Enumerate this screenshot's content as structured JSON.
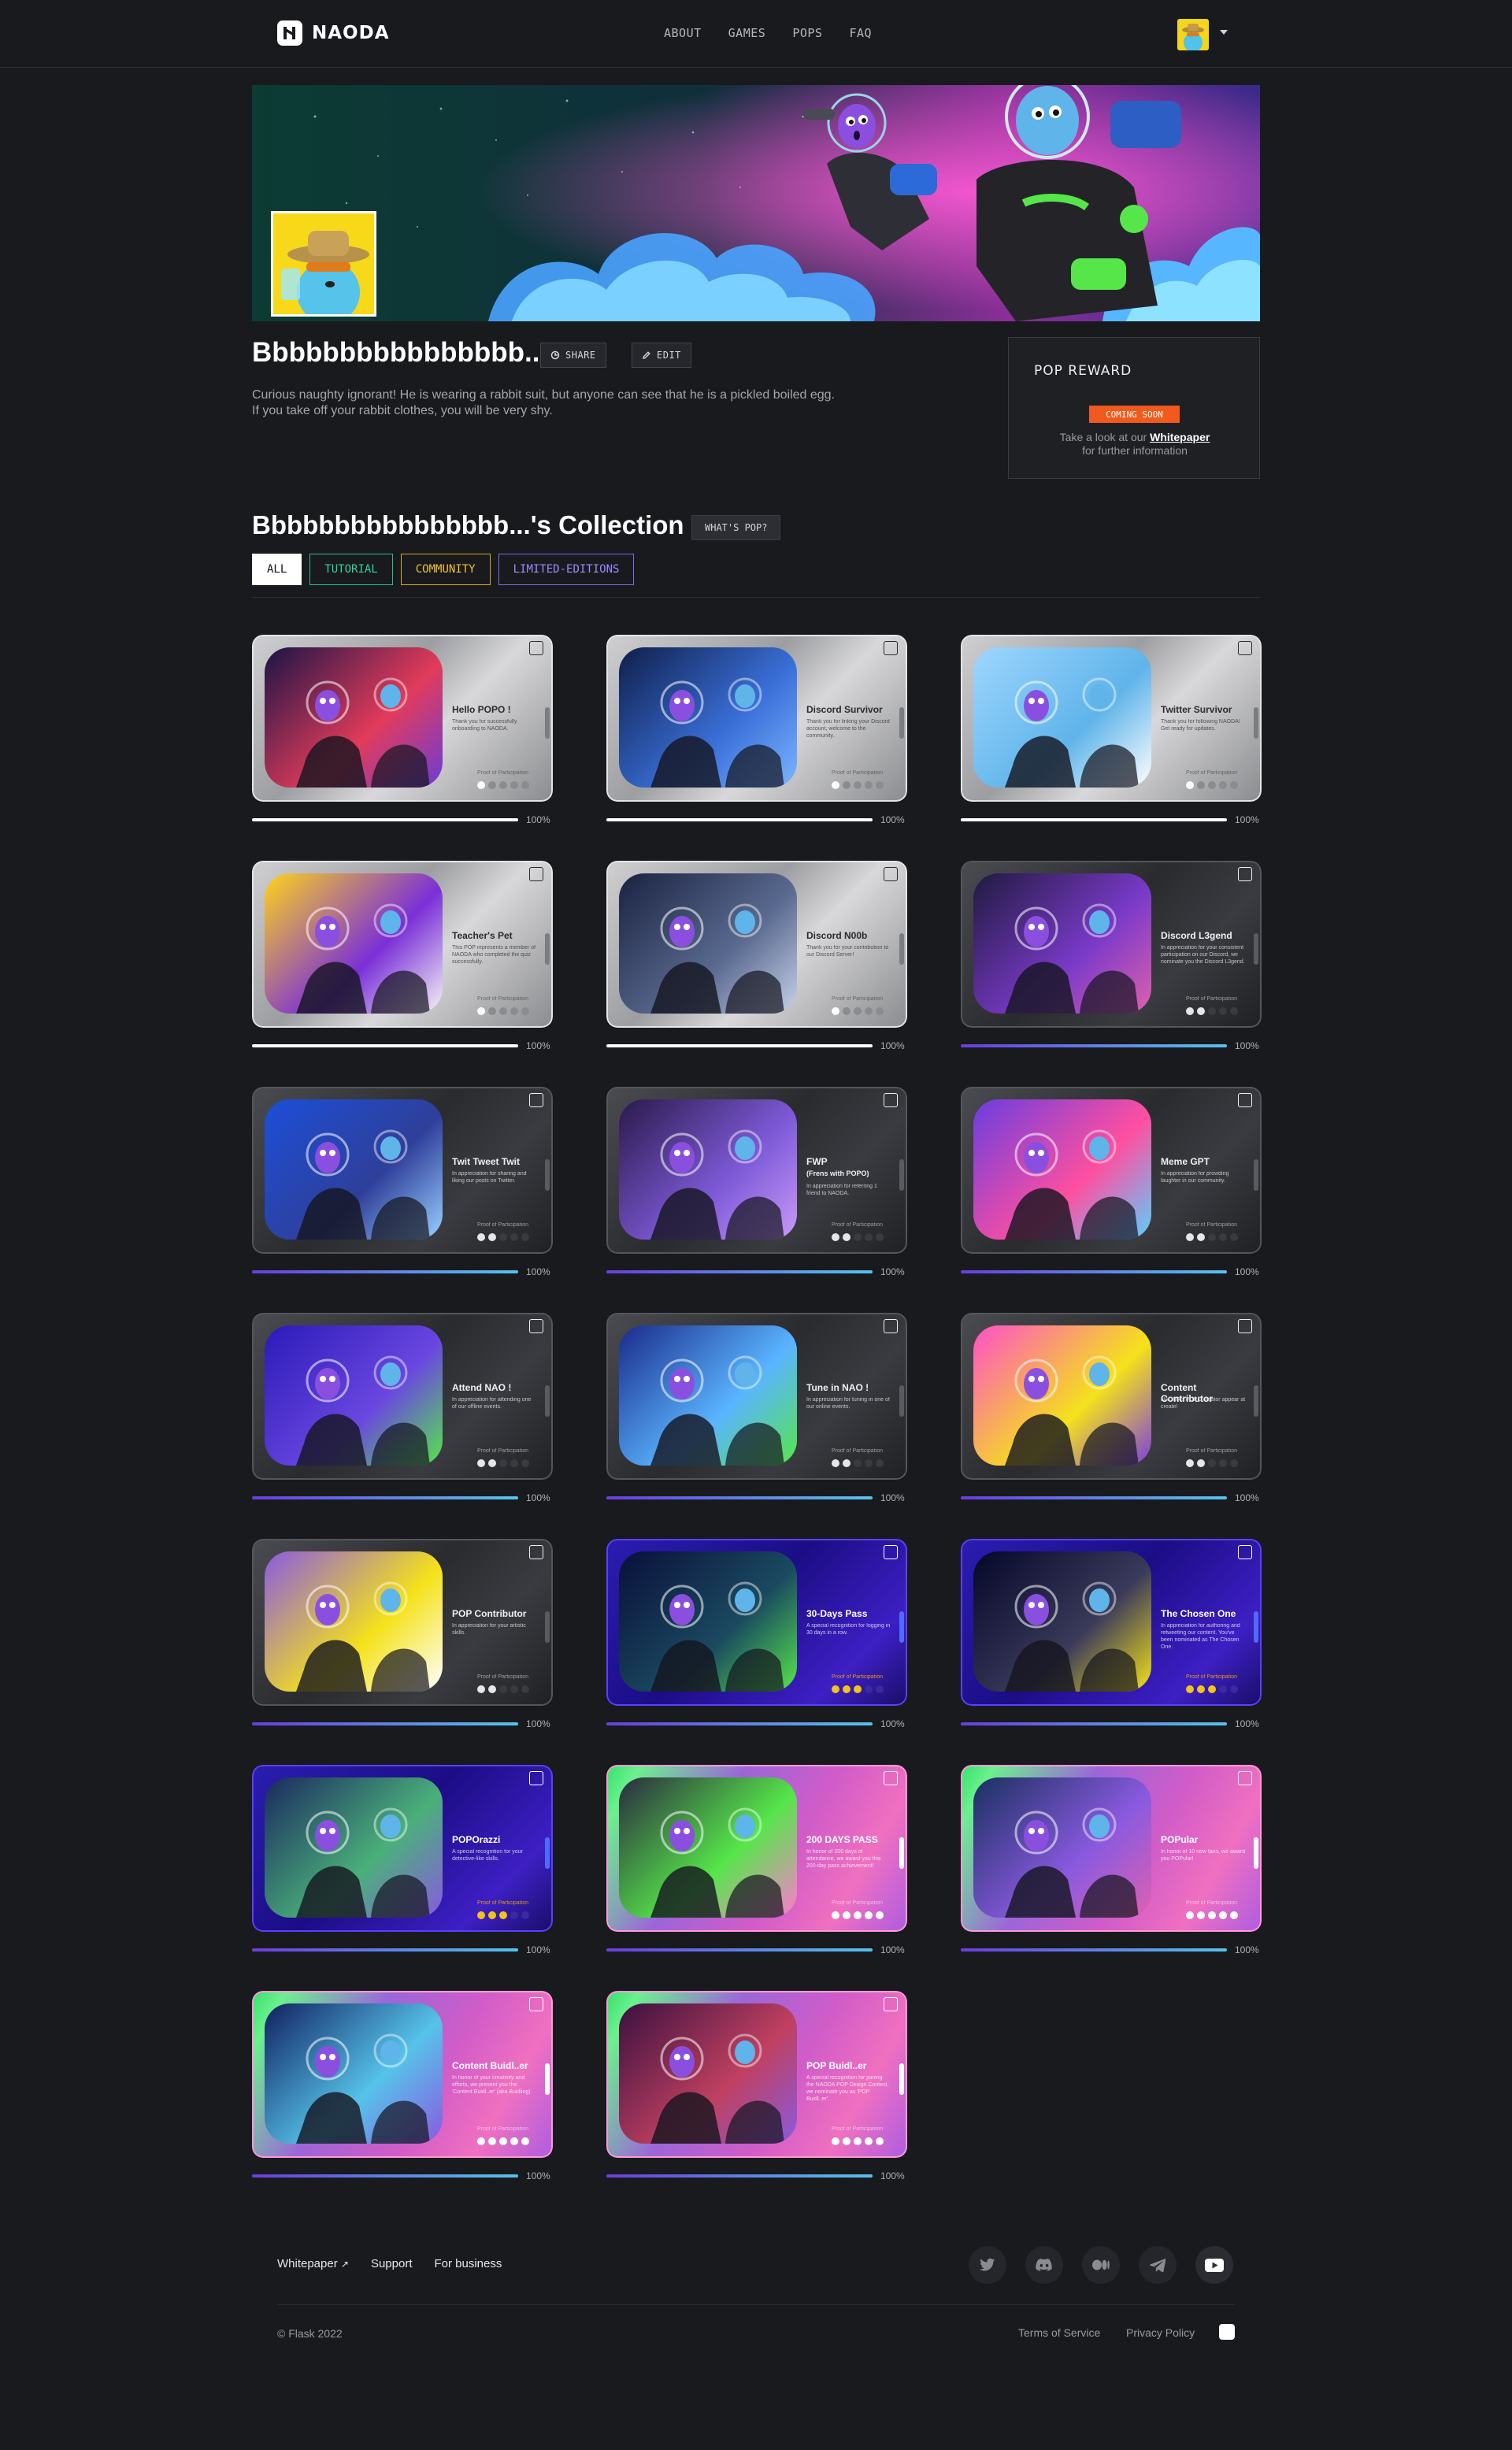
{
  "nav": {
    "brand": "NAODA",
    "items": [
      "ABOUT",
      "GAMES",
      "POPS",
      "FAQ"
    ]
  },
  "profile": {
    "name": "Bbbbbbbbbbbbbbbb...",
    "share_label": "SHARE",
    "edit_label": "EDIT",
    "bio_line1": "Curious naughty ignorant! He is wearing a rabbit suit, but anyone can see that he is a pickled boiled egg.",
    "bio_line2": "If you take off your rabbit clothes, you will be very shy."
  },
  "reward": {
    "title": "POP REWARD",
    "badge": "COMING SOON",
    "note_prefix": "Take a look at our ",
    "note_link": "Whitepaper",
    "note_suffix": "for further information"
  },
  "collection": {
    "title": "Bbbbbbbbbbbbbbbb...'s Collection",
    "whats_pop": "WHAT'S POP?",
    "filters": [
      "ALL",
      "TUTORIAL",
      "COMMUNITY",
      "LIMITED-EDITIONS"
    ],
    "pop_label": "Proof of Participation",
    "cards": [
      {
        "title": "Hello POPO !",
        "desc": "Thank you for successfully onboarding to NAODA.",
        "progress": "100%",
        "stars_on": 1,
        "stars_total": 5
      },
      {
        "title": "Discord Survivor",
        "desc": "Thank you for linking your Discord account, welcome to the community.",
        "progress": "100%",
        "stars_on": 1,
        "stars_total": 5
      },
      {
        "title": "Twitter Survivor",
        "desc": "Thank you for following NAODA! Get ready for updates.",
        "progress": "100%",
        "stars_on": 1,
        "stars_total": 5
      },
      {
        "title": "Teacher's Pet",
        "desc": "This POP represents a member of NAODA who completed the quiz successfully.",
        "progress": "100%",
        "stars_on": 1,
        "stars_total": 5
      },
      {
        "title": "Discord N00b",
        "desc": "Thank you for your contribution to our Discord Server!",
        "progress": "100%",
        "stars_on": 1,
        "stars_total": 5
      },
      {
        "title": "Discord L3gend",
        "desc": "In appreciation for your consistent participation on our Discord, we nominate you the Discord L3gend.",
        "progress": "100%",
        "stars_on": 2,
        "stars_total": 5
      },
      {
        "title": "Twit Tweet Twit",
        "desc": "In appreciation for sharing and liking our posts on Twitter.",
        "progress": "100%",
        "stars_on": 2,
        "stars_total": 5
      },
      {
        "title": "FWP",
        "subtitle": "(Frens with POPO)",
        "desc": "In appreciation for referring 1 friend to NAODA.",
        "progress": "100%",
        "stars_on": 2,
        "stars_total": 5
      },
      {
        "title": "Meme GPT",
        "desc": "In appreciation for providing laughter in our community.",
        "progress": "100%",
        "stars_on": 2,
        "stars_total": 5
      },
      {
        "title": "Attend NAO !",
        "desc": "In appreciation for attending one of our offline events.",
        "progress": "100%",
        "stars_on": 2,
        "stars_total": 5
      },
      {
        "title": "Tune in NAO !",
        "desc": "In appreciation for tuning in one of our online events.",
        "progress": "100%",
        "stars_on": 2,
        "stars_total": 5
      },
      {
        "title": "Content Contributor",
        "desc": "NAODA's POPO creator appear at create!",
        "progress": "100%",
        "stars_on": 2,
        "stars_total": 5
      },
      {
        "title": "POP Contributor",
        "desc": "In appreciation for your artistic skills.",
        "progress": "100%",
        "stars_on": 2,
        "stars_total": 5
      },
      {
        "title": "30-Days Pass",
        "desc": "A special recognition for logging in 30 days in a row.",
        "progress": "100%",
        "stars_on": 3,
        "stars_total": 5
      },
      {
        "title": "The Chosen One",
        "desc": "In appreciation for authoring and retweeting our content. You've been nominated as The Chosen One.",
        "progress": "100%",
        "stars_on": 3,
        "stars_total": 5
      },
      {
        "title": "POPOrazzi",
        "desc": "A special recognition for your detective-like skills.",
        "progress": "100%",
        "stars_on": 3,
        "stars_total": 5
      },
      {
        "title": "200 DAYS PASS",
        "desc": "In honor of 200 days of attendance, we award you this 200-day pass achievement!",
        "progress": "100%",
        "stars_on": 5,
        "stars_total": 5
      },
      {
        "title": "POPular",
        "desc": "In honor of 10 new fans, we award you POPular!",
        "progress": "100%",
        "stars_on": 5,
        "stars_total": 5
      },
      {
        "title": "Content Buidl..er",
        "desc": "In honor of your creativity and efforts, we present you the 'Content Buidl..er' (aka Buidling).",
        "progress": "100%",
        "stars_on": 5,
        "stars_total": 5
      },
      {
        "title": "POP Buidl..er",
        "desc": "A special recognition for joining the NAODA POP Design Contest, we nominate you as 'POP Buidl..er'.",
        "progress": "100%",
        "stars_on": 5,
        "stars_total": 5
      }
    ]
  },
  "footer": {
    "links": [
      "Whitepaper",
      "Support",
      "For business"
    ],
    "social": [
      "twitter-icon",
      "discord-icon",
      "medium-icon",
      "telegram-icon",
      "youtube-icon"
    ],
    "copyright": "© Flask 2022",
    "terms": "Terms of Service",
    "privacy": "Privacy Policy"
  },
  "colors": {
    "background": "#191a1e",
    "accent_orange": "#f05a1c",
    "tutorial": "#34d399",
    "community": "#f0c330",
    "limited": "#9a8cff"
  }
}
